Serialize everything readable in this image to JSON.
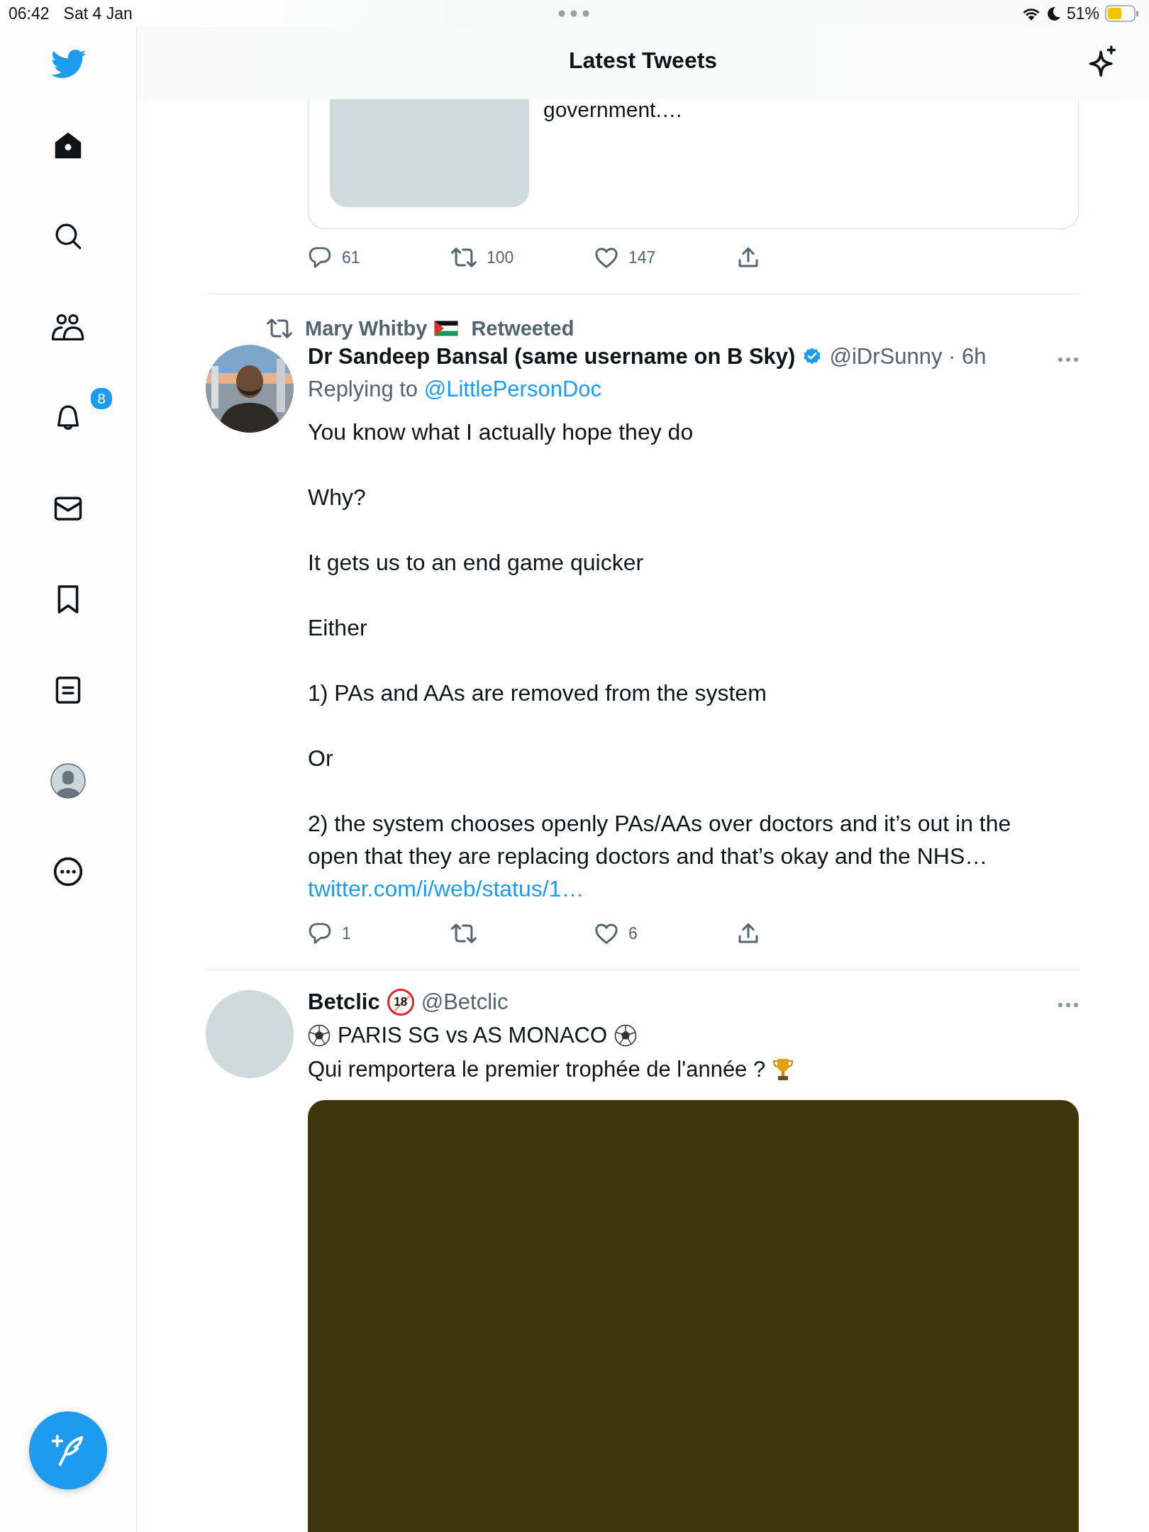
{
  "status_bar": {
    "time": "06:42",
    "date": "Sat 4 Jan",
    "battery": "51%"
  },
  "header": {
    "title": "Latest Tweets"
  },
  "sidebar": {
    "items": [
      {
        "kind": "home",
        "selected": true
      },
      {
        "kind": "search",
        "selected": false
      },
      {
        "kind": "communities",
        "selected": false
      },
      {
        "kind": "notifications",
        "selected": false,
        "badge": "8"
      },
      {
        "kind": "messages",
        "selected": false
      },
      {
        "kind": "bookmarks",
        "selected": false
      },
      {
        "kind": "lists",
        "selected": false
      },
      {
        "kind": "profile",
        "selected": false
      },
      {
        "kind": "more",
        "selected": false
      }
    ]
  },
  "tweets": [
    {
      "kind": "quote_tail",
      "card_text": "government.…",
      "actions": {
        "replies": "61",
        "retweets": "100",
        "likes": "147"
      }
    },
    {
      "kind": "tweet",
      "social_context": {
        "name": "Mary Whitby",
        "label": "Retweeted"
      },
      "author": {
        "name": "Dr Sandeep Bansal (same username on B Sky)",
        "verified": true
      },
      "meta": "@iDrSunny · 6h",
      "replying_to": {
        "label": "Replying to",
        "handle": "@LittlePersonDoc"
      },
      "lines": [
        {
          "kind": "plain",
          "text": "You know what I actually hope they do"
        },
        {
          "kind": "plain",
          "text": "Why?"
        },
        {
          "kind": "plain",
          "text": "It gets us to an end game quicker"
        },
        {
          "kind": "plain",
          "text": "Either"
        },
        {
          "kind": "plain",
          "text": "1) PAs and AAs are removed from the system"
        },
        {
          "kind": "plain",
          "text": "Or"
        },
        {
          "kind": "plain",
          "text": "2) the system chooses openly PAs/AAs over doctors and it’s out in the open that they are replacing doctors and that’s okay and the NHS…"
        }
      ],
      "link": "twitter.com/i/web/status/1…",
      "actions": {
        "replies": "1",
        "likes": "6"
      }
    },
    {
      "kind": "tweet",
      "avatar": {
        "kind": "blank"
      },
      "author": {
        "name": "Betclic",
        "verified": false,
        "age_badge": "18"
      },
      "meta": "@Betclic",
      "lines": [
        {
          "kind": "ball_framed",
          "text": "PARIS SG vs AS MONACO"
        },
        {
          "kind": "trophy_end",
          "text": "Qui remportera le premier trophée de l'année ?"
        }
      ],
      "media": {
        "kind": "placeholder"
      }
    }
  ]
}
